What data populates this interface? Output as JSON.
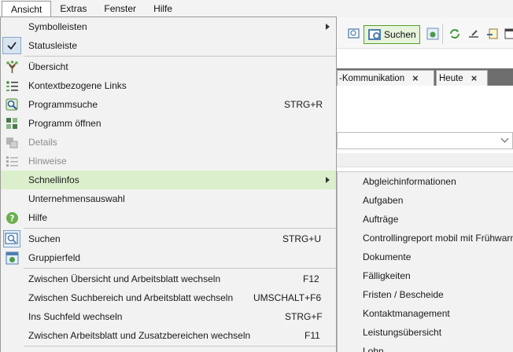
{
  "menubar": {
    "items": [
      {
        "label": "Ansicht"
      },
      {
        "label": "Extras"
      },
      {
        "label": "Fenster"
      },
      {
        "label": "Hilfe"
      }
    ]
  },
  "toolbar": {
    "search_label": "Suchen"
  },
  "tabs": [
    {
      "label": "-Kommunikation"
    },
    {
      "label": "Heute"
    }
  ],
  "menu": {
    "items": [
      {
        "label": "Symbolleisten",
        "shortcut": "",
        "submenu": true
      },
      {
        "label": "Statusleiste",
        "shortcut": "",
        "checked": true
      },
      {
        "label": "Übersicht",
        "shortcut": ""
      },
      {
        "label": "Kontextbezogene Links",
        "shortcut": ""
      },
      {
        "label": "Programmsuche",
        "shortcut": "STRG+R"
      },
      {
        "label": "Programm öffnen",
        "shortcut": ""
      },
      {
        "label": "Details",
        "shortcut": "",
        "disabled": true
      },
      {
        "label": "Hinweise",
        "shortcut": "",
        "disabled": true
      },
      {
        "label": "Schnellinfos",
        "shortcut": "",
        "submenu": true,
        "highlighted": true
      },
      {
        "label": "Unternehmensauswahl",
        "shortcut": ""
      },
      {
        "label": "Hilfe",
        "shortcut": ""
      },
      {
        "label": "Suchen",
        "shortcut": "STRG+U",
        "checked": true
      },
      {
        "label": "Gruppierfeld",
        "shortcut": ""
      },
      {
        "label": "Zwischen Übersicht und Arbeitsblatt wechseln",
        "shortcut": "F12"
      },
      {
        "label": "Zwischen Suchbereich und Arbeitsblatt wechseln",
        "shortcut": "UMSCHALT+F6"
      },
      {
        "label": "Ins Suchfeld wechseln",
        "shortcut": "STRG+F"
      },
      {
        "label": "Zwischen Arbeitsblatt und Zusatzbereichen wechseln",
        "shortcut": "F11"
      }
    ]
  },
  "submenu": {
    "items": [
      {
        "label": "Abgleichinformationen"
      },
      {
        "label": "Aufgaben"
      },
      {
        "label": "Aufträge"
      },
      {
        "label": "Controllingreport mobil mit Frühwarn"
      },
      {
        "label": "Dokumente"
      },
      {
        "label": "Fälligkeiten"
      },
      {
        "label": "Fristen / Bescheide"
      },
      {
        "label": "Kontaktmanagement"
      },
      {
        "label": "Leistungsübersicht"
      },
      {
        "label": "Lohn"
      }
    ]
  },
  "colors": {
    "highlight": "#dcefcc",
    "accent_green": "#58a030",
    "menu_bg": "#f2f2f2"
  }
}
